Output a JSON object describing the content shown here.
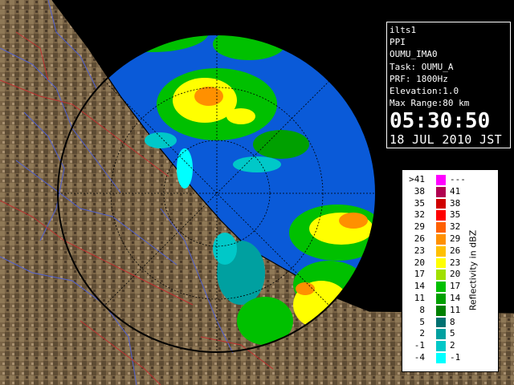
{
  "info": {
    "station": "ilts1",
    "scan_type": "PPI",
    "product": "OUMU_IMA0",
    "task": "Task: OUMU_A",
    "prf": "PRF: 1800Hz",
    "elevation": "Elevation:1.0",
    "max_range": "Max Range:80 km",
    "time": "05:30:50",
    "date": "18 JUL 2010 JST"
  },
  "legend": {
    "unit_label": "Reflectivity in dBZ",
    "rows": [
      {
        "low": ">41",
        "high": "---",
        "color": "#ff00ff"
      },
      {
        "low": "38",
        "high": "41",
        "color": "#b00050"
      },
      {
        "low": "35",
        "high": "38",
        "color": "#d00000"
      },
      {
        "low": "32",
        "high": "35",
        "color": "#ff0000"
      },
      {
        "low": "29",
        "high": "32",
        "color": "#ff6000"
      },
      {
        "low": "26",
        "high": "29",
        "color": "#ff9000"
      },
      {
        "low": "23",
        "high": "26",
        "color": "#ffc000"
      },
      {
        "low": "20",
        "high": "23",
        "color": "#ffff00"
      },
      {
        "low": "17",
        "high": "20",
        "color": "#a0e000"
      },
      {
        "low": "14",
        "high": "17",
        "color": "#00c000"
      },
      {
        "low": "11",
        "high": "14",
        "color": "#00a000"
      },
      {
        "low": "8",
        "high": "11",
        "color": "#008000"
      },
      {
        "low": "5",
        "high": "8",
        "color": "#007070"
      },
      {
        "low": "2",
        "high": "5",
        "color": "#00a0a0"
      },
      {
        "low": "-1",
        "high": "2",
        "color": "#00c8c8"
      },
      {
        "low": "-4",
        "high": "-1",
        "color": "#00ffff"
      }
    ]
  },
  "colors": {
    "sea": "#0a5ad8",
    "sea_outer": "#0a28c8",
    "land": "#806a4a"
  }
}
